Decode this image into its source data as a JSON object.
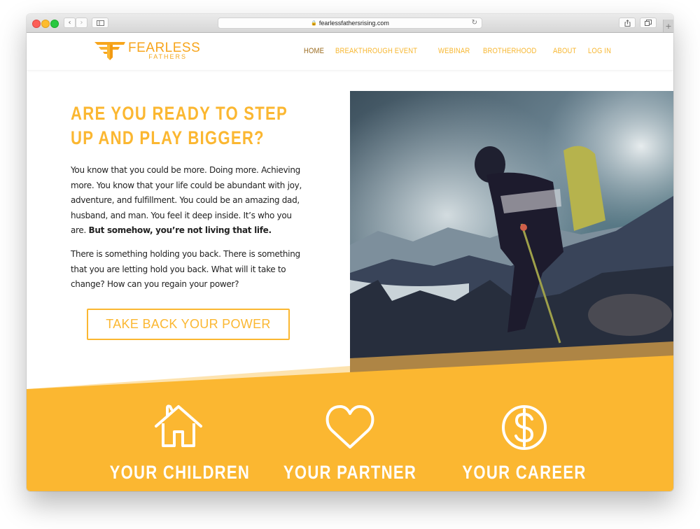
{
  "browser": {
    "url": "fearlessfathersrising.com",
    "icons": {
      "back": "chevron-left-icon",
      "forward": "chevron-right-icon",
      "sidebar": "sidebar-icon",
      "lock": "lock-icon",
      "reload": "reload-icon",
      "share": "share-icon",
      "tabs": "tabs-icon",
      "new_tab": "plus-icon"
    }
  },
  "header": {
    "logo": {
      "line1": "FEARLESS",
      "line2": "FATHERS"
    },
    "nav": [
      {
        "label": "HOME",
        "active": true
      },
      {
        "label": "BREAKTHROUGH EVENT",
        "active": false
      },
      {
        "label": "WEBINAR",
        "active": false
      },
      {
        "label": "BROTHERHOOD",
        "active": false
      },
      {
        "label": "ABOUT",
        "active": false
      },
      {
        "label": "LOG IN",
        "active": false
      }
    ]
  },
  "hero": {
    "title": "ARE YOU READY TO STEP UP AND PLAY BIGGER?",
    "paragraph1": "You know that you could be more.  Doing more.  Achieving more.  You know that your life could be abundant with joy, adventure, and fulfillment.  You could be an amazing dad, husband, and man.  You feel it deep inside.  It’s who you are. ",
    "paragraph1_bold": "But somehow, you’re not living that life.",
    "paragraph2": "There is something holding you back.  There is something that you are letting hold you back.  What will it take to change?  How can you regain your power?",
    "cta_label": "TAKE BACK YOUR POWER",
    "image_alt": "Hiker with yellow backpack and trekking pole on a misty mountain ridge"
  },
  "features": [
    {
      "icon": "house-icon",
      "label": "YOUR CHILDREN"
    },
    {
      "icon": "heart-icon",
      "label": "YOUR PARTNER"
    },
    {
      "icon": "dollar-circle-icon",
      "label": "YOUR CAREER"
    }
  ],
  "colors": {
    "brand_yellow": "#fbb731",
    "nav_active": "#9a6a1e",
    "logo_orange": "#f7a51c",
    "body_text": "#222222"
  }
}
